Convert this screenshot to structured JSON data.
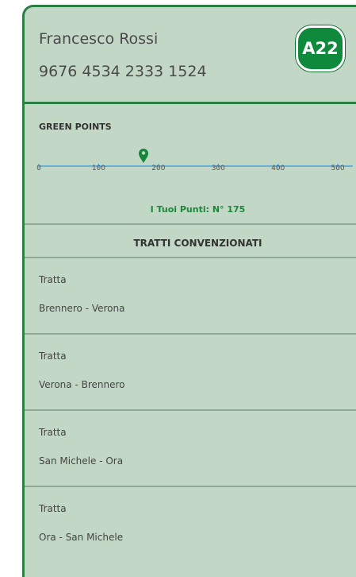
{
  "user": {
    "name": "Francesco Rossi",
    "card_number": "9676 4534 2333 1524"
  },
  "logo": {
    "text": "A22"
  },
  "green_points": {
    "title": "GREEN POINTS",
    "scale_ticks": [
      "0",
      "100",
      "200",
      "300",
      "400",
      "500"
    ],
    "current_value": 175,
    "scale_max": 525,
    "points_text": "I Tuoi Punti: N° 175"
  },
  "section": {
    "title": "TRATTI CONVENZIONATI"
  },
  "routes": [
    {
      "label": "Tratta",
      "name": "Brennero - Verona"
    },
    {
      "label": "Tratta",
      "name": "Verona - Brennero"
    },
    {
      "label": "Tratta",
      "name": "San Michele - Ora"
    },
    {
      "label": "Tratta",
      "name": "Ora - San Michele"
    }
  ],
  "colors": {
    "background": "#c3d7c6",
    "accent": "#2b7f43",
    "points_text": "#1a8a3a",
    "scale_line": "#4aa3d8"
  }
}
